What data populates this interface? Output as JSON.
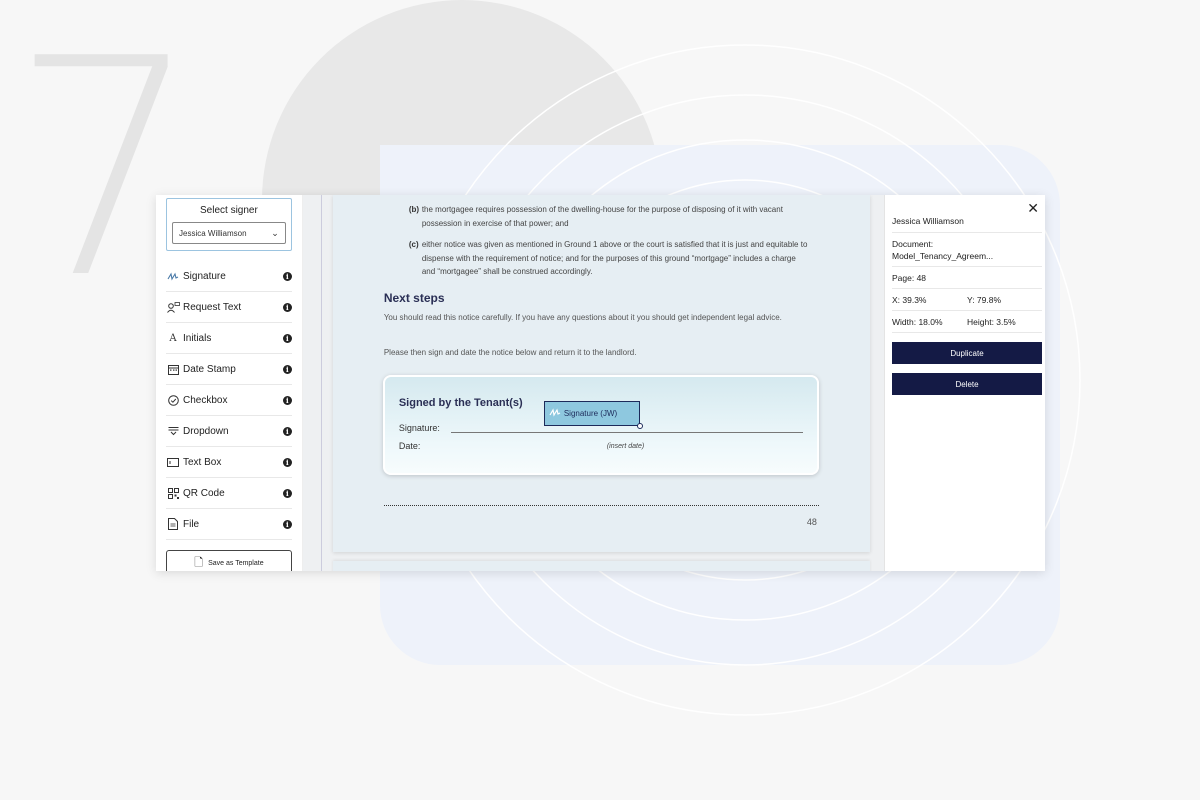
{
  "background": {
    "step_number": "7"
  },
  "left_panel": {
    "signer_title": "Select signer",
    "signer_value": "Jessica Williamson",
    "tools": [
      {
        "icon": "signature-icon",
        "label": "Signature"
      },
      {
        "icon": "request-text-icon",
        "label": "Request Text"
      },
      {
        "icon": "initials-icon",
        "label": "Initials"
      },
      {
        "icon": "date-stamp-icon",
        "label": "Date Stamp"
      },
      {
        "icon": "checkbox-icon",
        "label": "Checkbox"
      },
      {
        "icon": "dropdown-icon",
        "label": "Dropdown"
      },
      {
        "icon": "text-box-icon",
        "label": "Text Box"
      },
      {
        "icon": "qr-code-icon",
        "label": "QR Code"
      },
      {
        "icon": "file-icon",
        "label": "File"
      }
    ],
    "save_template_label": "Save as Template"
  },
  "document": {
    "clause_b_marker": "(b)",
    "clause_b": "the mortgagee requires possession of the dwelling-house for the purpose of disposing of it with vacant possession in exercise of that power; and",
    "clause_c_marker": "(c)",
    "clause_c": "either notice was given as mentioned in Ground 1 above or the court is satisfied that it is just and equitable to dispense with the requirement of notice; and for the purposes of this ground “mortgage” includes a charge and “mortgagee” shall be construed accordingly.",
    "next_steps_heading": "Next steps",
    "para1": "You should read this notice carefully. If you have any questions about it you should get independent legal advice.",
    "para2": "Please then sign and date the notice below and return it to the landlord.",
    "sign_card": {
      "title": "Signed by the Tenant(s)",
      "signature_label": "Signature:",
      "date_label": "Date:",
      "insert_date": "(insert date)",
      "field_label": "Signature (JW)"
    },
    "page_number": "48"
  },
  "right_panel": {
    "signer_name": "Jessica Williamson",
    "document_label": "Document:",
    "document_name": "Model_Tenancy_Agreem...",
    "page": "Page: 48",
    "x": "X: 39.3%",
    "y": "Y: 79.8%",
    "width": "Width: 18.0%",
    "height": "Height: 3.5%",
    "duplicate_label": "Duplicate",
    "delete_label": "Delete"
  }
}
